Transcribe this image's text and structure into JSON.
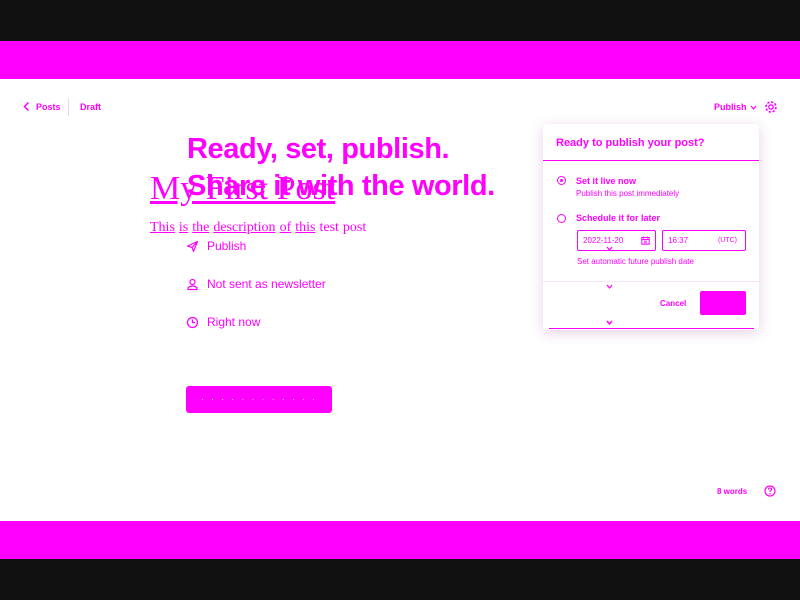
{
  "nav": {
    "back_label": "Posts",
    "status": "Draft",
    "publish_label": "Publish"
  },
  "post": {
    "title": "My First Post",
    "description_words": [
      {
        "text": "This",
        "underlined": true
      },
      {
        "text": "is",
        "underlined": true
      },
      {
        "text": "the",
        "underlined": true
      },
      {
        "text": "description",
        "underlined": true
      },
      {
        "text": "of",
        "underlined": true
      },
      {
        "text": "this",
        "underlined": true
      },
      {
        "text": "test",
        "underlined": false
      },
      {
        "text": "post",
        "underlined": false
      }
    ]
  },
  "publish_flow": {
    "headline_line1": "Ready, set, publish.",
    "headline_line2": "Share it with the world.",
    "options": [
      {
        "icon": "send-icon",
        "label": "Publish"
      },
      {
        "icon": "newsletter-user-icon",
        "label": "Not sent as newsletter"
      },
      {
        "icon": "clock-icon",
        "label": "Right now"
      }
    ]
  },
  "panel": {
    "title": "Ready to publish your post?",
    "option_now": {
      "label": "Set it live now",
      "sub": "Publish this post immediately",
      "selected": true
    },
    "option_later": {
      "label": "Schedule it for later",
      "selected": false
    },
    "date_value": "2022-11-20",
    "time_value": "16:37",
    "timezone": "(UTC)",
    "auto_note": "Set automatic future publish date",
    "cancel_label": "Cancel"
  },
  "footer": {
    "word_count": "8 words"
  },
  "colors": {
    "accent": "#ff00ff",
    "background": "#ffffff",
    "frame": "#111111"
  }
}
